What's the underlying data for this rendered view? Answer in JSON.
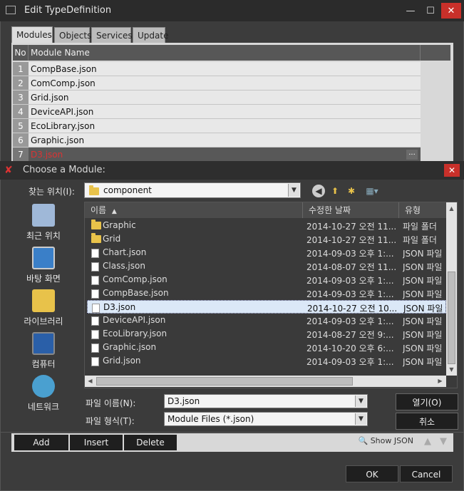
{
  "outer": {
    "title": "Edit TypeDefinition",
    "tabs": [
      "Modules",
      "Objects",
      "Services",
      "Update"
    ],
    "columns": {
      "no": "No",
      "name": "Module Name"
    },
    "rows": [
      {
        "no": "1",
        "name": "CompBase.json"
      },
      {
        "no": "2",
        "name": "ComComp.json"
      },
      {
        "no": "3",
        "name": "Grid.json"
      },
      {
        "no": "4",
        "name": "DeviceAPI.json"
      },
      {
        "no": "5",
        "name": "EcoLibrary.json"
      },
      {
        "no": "6",
        "name": "Graphic.json"
      },
      {
        "no": "7",
        "name": "D3.json"
      }
    ],
    "row_more": "...",
    "buttons": {
      "add": "Add",
      "insert": "Insert",
      "delete": "Delete",
      "show_json": "Show JSON",
      "ok": "OK",
      "cancel": "Cancel"
    }
  },
  "dialog": {
    "title": "Choose a Module:",
    "lookin_label": "찾는 위치(I):",
    "lookin_value": "component",
    "places": [
      "최근 위치",
      "바탕 화면",
      "라이브러리",
      "컴퓨터",
      "네트워크"
    ],
    "columns": {
      "name": "이름",
      "modified": "수정한 날짜",
      "type": "유형"
    },
    "files": [
      {
        "name": "Graphic",
        "modified": "2014-10-27 오전 11...",
        "type": "파일 폴더",
        "kind": "folder"
      },
      {
        "name": "Grid",
        "modified": "2014-10-27 오전 11...",
        "type": "파일 폴더",
        "kind": "folder"
      },
      {
        "name": "Chart.json",
        "modified": "2014-09-03 오후 1:...",
        "type": "JSON 파일",
        "kind": "file"
      },
      {
        "name": "Class.json",
        "modified": "2014-08-07 오전 11...",
        "type": "JSON 파일",
        "kind": "file"
      },
      {
        "name": "ComComp.json",
        "modified": "2014-09-03 오후 1:...",
        "type": "JSON 파일",
        "kind": "file"
      },
      {
        "name": "CompBase.json",
        "modified": "2014-09-03 오후 1:...",
        "type": "JSON 파일",
        "kind": "file"
      },
      {
        "name": "D3.json",
        "modified": "2014-10-27 오전 10...",
        "type": "JSON 파일",
        "kind": "file"
      },
      {
        "name": "DeviceAPI.json",
        "modified": "2014-09-03 오후 1:...",
        "type": "JSON 파일",
        "kind": "file"
      },
      {
        "name": "EcoLibrary.json",
        "modified": "2014-08-27 오전 9:...",
        "type": "JSON 파일",
        "kind": "file"
      },
      {
        "name": "Graphic.json",
        "modified": "2014-10-20 오후 6:...",
        "type": "JSON 파일",
        "kind": "file"
      },
      {
        "name": "Grid.json",
        "modified": "2014-09-03 오후 1:...",
        "type": "JSON 파일",
        "kind": "file"
      }
    ],
    "filename_label": "파일 이름(N):",
    "filename_value": "D3.json",
    "filetype_label": "파일 형식(T):",
    "filetype_value": "Module Files (*.json)",
    "open_button": "열기(O)",
    "cancel_button": "취소"
  },
  "colors": {
    "selection_text": "#dd3333",
    "close": "#c8302a"
  }
}
